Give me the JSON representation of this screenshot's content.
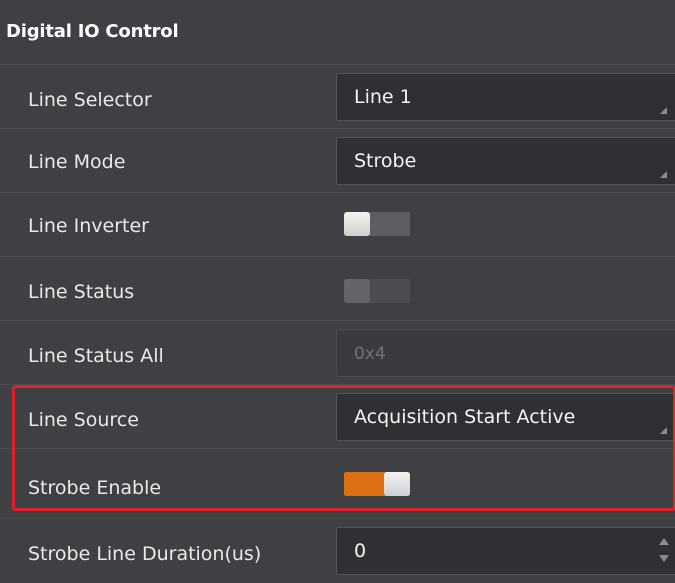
{
  "section": {
    "title": "Digital IO Control"
  },
  "rows": {
    "line_selector": {
      "label": "Line Selector",
      "value": "Line 1"
    },
    "line_mode": {
      "label": "Line Mode",
      "value": "Strobe"
    },
    "line_inverter": {
      "label": "Line Inverter",
      "checked": false
    },
    "line_status": {
      "label": "Line Status",
      "checked": false,
      "enabled": false
    },
    "line_status_all": {
      "label": "Line Status All",
      "value": "0x4"
    },
    "line_source": {
      "label": "Line Source",
      "value": "Acquisition Start Active"
    },
    "strobe_enable": {
      "label": "Strobe Enable",
      "checked": true
    },
    "strobe_duration": {
      "label": "Strobe Line Duration(us)",
      "value": "0"
    }
  },
  "colors": {
    "toggle_on": "#dc6e13",
    "highlight_border": "#e0212b"
  }
}
